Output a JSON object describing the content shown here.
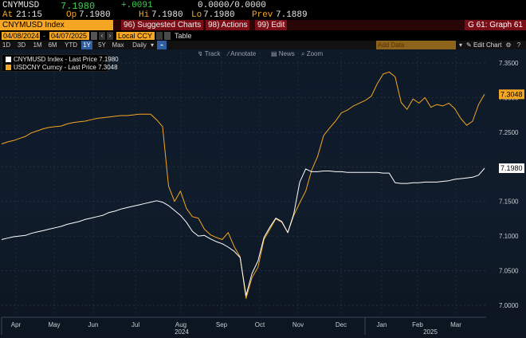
{
  "quote": {
    "ticker": "CNYMUSD",
    "last": "7.1980",
    "change": "+.0091",
    "bid_ask": "0.0000/0.0000",
    "at_label": "At",
    "at_time": "21:15",
    "op_label": "Op",
    "op_value": "7.1980",
    "hi_label": "Hi",
    "hi_value": "7.1980",
    "lo_label": "Lo",
    "lo_value": "7.1980",
    "prev_label": "Prev",
    "prev_value": "7.1889"
  },
  "titlebar": {
    "security": "CNYMUSD Index",
    "suggested": "96) Suggested Charts",
    "actions": "98) Actions",
    "edit": "99) Edit",
    "graph": "G 61: Graph 61"
  },
  "dates": {
    "start": "04/08/2024",
    "end": "04/07/2025",
    "currency": "Local CCY",
    "table": "Table"
  },
  "ranges": [
    "1D",
    "3D",
    "1M",
    "6M",
    "YTD",
    "1Y",
    "5Y",
    "Max",
    "Daily"
  ],
  "active_range": "1Y",
  "add_data": "Add Data",
  "edit_chart": "Edit Chart",
  "tools": [
    "Track",
    "Annotate",
    "News",
    "Zoom"
  ],
  "legend": [
    {
      "label": "CNYMUSD Index - Last Price 7.1980",
      "color": "#ffffff"
    },
    {
      "label": "USDCNY Curncy - Last Price 7.3048",
      "color": "#f5a623"
    }
  ],
  "chart_data": {
    "type": "line",
    "y_ticks": [
      "7.3500",
      "7.3000",
      "7.2500",
      "7.2000",
      "7.1500",
      "7.1000",
      "7.0500",
      "7.0000"
    ],
    "ylim": [
      6.985,
      7.365
    ],
    "x_months": [
      "Apr",
      "May",
      "Jun",
      "Jul",
      "Aug",
      "Sep",
      "Oct",
      "Nov",
      "Dec",
      "Jan",
      "Feb",
      "Mar"
    ],
    "x_years": [
      "2024",
      "2025"
    ],
    "last_labels": [
      {
        "text": "7.3048",
        "color": "#f5a623"
      },
      {
        "text": "7.1980",
        "color": "#ffffff"
      }
    ],
    "series": [
      {
        "name": "USDCNY Curncy",
        "color": "#f5a623",
        "values": [
          7.233,
          7.236,
          7.238,
          7.241,
          7.244,
          7.249,
          7.252,
          7.255,
          7.257,
          7.258,
          7.259,
          7.262,
          7.264,
          7.265,
          7.266,
          7.268,
          7.27,
          7.271,
          7.272,
          7.273,
          7.274,
          7.274,
          7.275,
          7.276,
          7.276,
          7.276,
          7.268,
          7.258,
          7.172,
          7.15,
          7.165,
          7.14,
          7.128,
          7.126,
          7.11,
          7.102,
          7.098,
          7.095,
          7.105,
          7.085,
          7.07,
          7.01,
          7.04,
          7.055,
          7.095,
          7.11,
          7.125,
          7.12,
          7.105,
          7.13,
          7.148,
          7.165,
          7.195,
          7.215,
          7.245,
          7.256,
          7.266,
          7.278,
          7.282,
          7.288,
          7.292,
          7.296,
          7.302,
          7.32,
          7.334,
          7.337,
          7.33,
          7.293,
          7.283,
          7.298,
          7.292,
          7.3,
          7.286,
          7.29,
          7.288,
          7.292,
          7.284,
          7.27,
          7.26,
          7.266,
          7.29,
          7.305
        ]
      },
      {
        "name": "CNYMUSD Index",
        "color": "#ffffff",
        "values": [
          7.095,
          7.097,
          7.099,
          7.1,
          7.101,
          7.104,
          7.106,
          7.108,
          7.11,
          7.112,
          7.114,
          7.117,
          7.119,
          7.121,
          7.124,
          7.126,
          7.128,
          7.13,
          7.134,
          7.136,
          7.139,
          7.141,
          7.143,
          7.145,
          7.147,
          7.149,
          7.151,
          7.149,
          7.144,
          7.137,
          7.13,
          7.12,
          7.107,
          7.1,
          7.101,
          7.096,
          7.092,
          7.089,
          7.084,
          7.078,
          7.069,
          7.014,
          7.046,
          7.064,
          7.098,
          7.113,
          7.126,
          7.121,
          7.105,
          7.132,
          7.178,
          7.197,
          7.193,
          7.193,
          7.194,
          7.194,
          7.193,
          7.193,
          7.192,
          7.192,
          7.192,
          7.192,
          7.192,
          7.192,
          7.191,
          7.191,
          7.177,
          7.176,
          7.176,
          7.177,
          7.177,
          7.178,
          7.178,
          7.178,
          7.179,
          7.18,
          7.182,
          7.183,
          7.184,
          7.185,
          7.188,
          7.198
        ]
      }
    ]
  }
}
